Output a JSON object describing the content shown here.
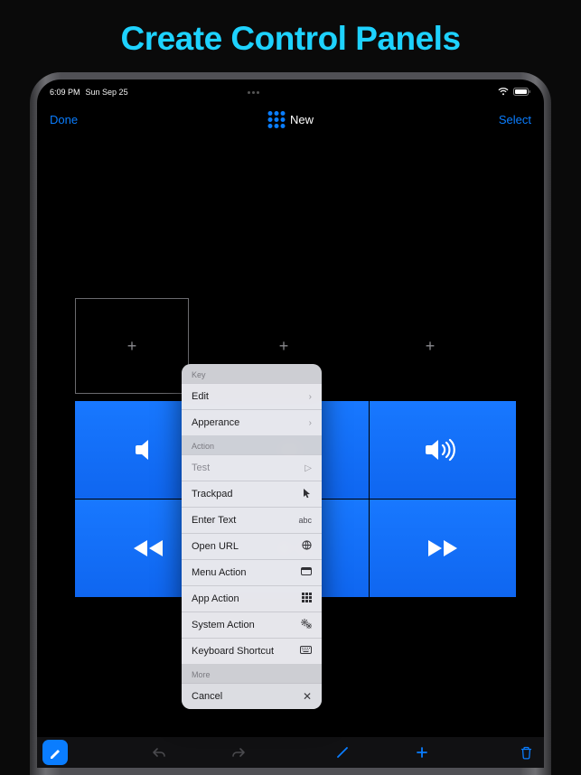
{
  "headline": "Create Control Panels",
  "statusbar": {
    "time": "6:09 PM",
    "date": "Sun Sep 25"
  },
  "navbar": {
    "done": "Done",
    "title": "New",
    "select": "Select"
  },
  "slots": {
    "plus": "+"
  },
  "popover": {
    "section_key": "Key",
    "edit": "Edit",
    "appearance": "Apperance",
    "section_action": "Action",
    "test": "Test",
    "trackpad": "Trackpad",
    "enter_text": "Enter Text",
    "enter_text_glyph": "abc",
    "open_url": "Open URL",
    "menu_action": "Menu Action",
    "app_action": "App Action",
    "system_action": "System Action",
    "keyboard_shortcut": "Keyboard Shortcut",
    "section_more": "More",
    "cancel": "Cancel"
  }
}
